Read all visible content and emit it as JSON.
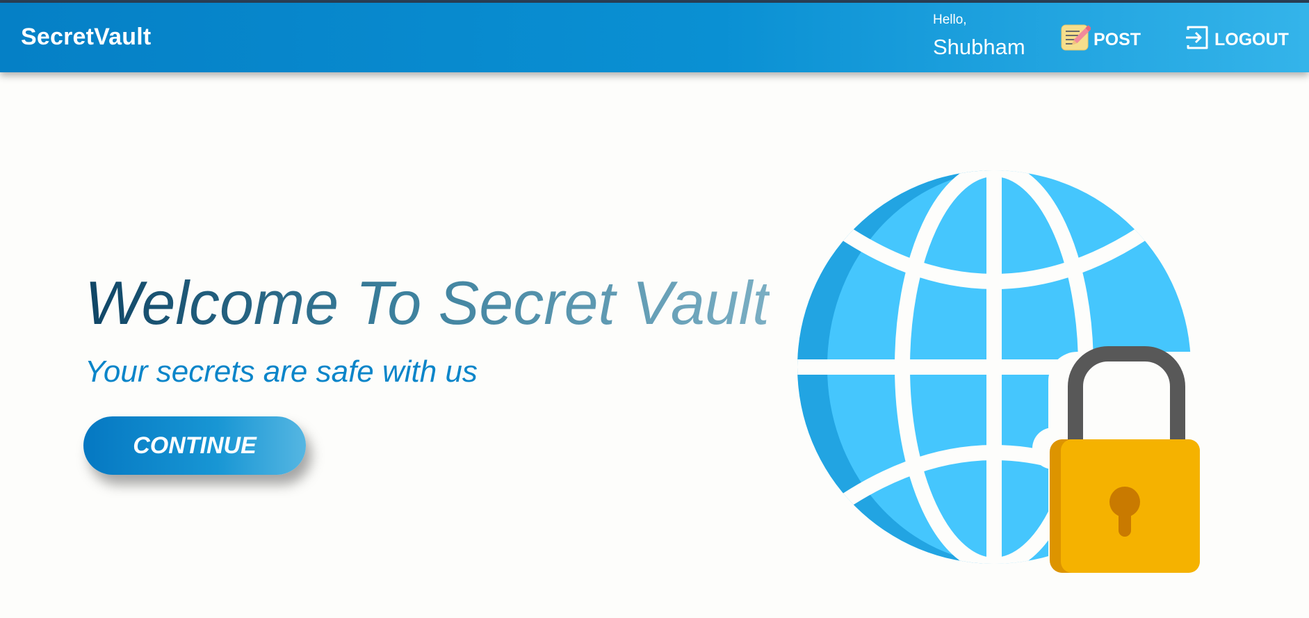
{
  "navbar": {
    "brand": "SecretVault",
    "greeting": "Hello,",
    "username": "Shubham",
    "post_label": "POST",
    "logout_label": "LOGOUT",
    "post_icon": "notepad-pencil-icon",
    "logout_icon": "logout-arrow-icon"
  },
  "hero": {
    "title": "Welcome To Secret Vault",
    "subtitle": "Your secrets are safe with us",
    "cta_label": "CONTINUE",
    "illustration": "globe-with-padlock-icon"
  },
  "colors": {
    "navbar_start": "#0580c6",
    "navbar_end": "#34b4ea",
    "accent": "#0a85c9",
    "globe": "#45c6fd",
    "padlock": "#f5b200",
    "background": "#fdfdfb"
  }
}
